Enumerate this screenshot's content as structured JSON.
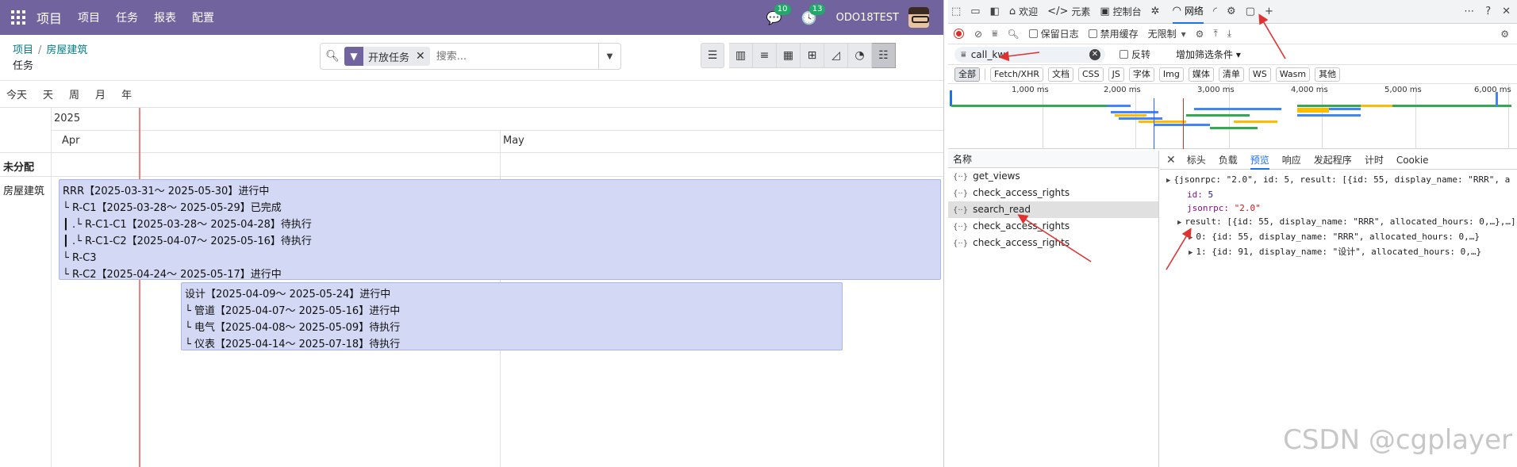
{
  "odoo": {
    "nav": {
      "brand": "项目",
      "links": [
        "项目",
        "任务",
        "报表",
        "配置"
      ],
      "chat_badge": "10",
      "activity_badge": "13",
      "user": "ODO18TEST"
    },
    "breadcrumb": {
      "parent": "项目",
      "current": "房屋建筑"
    },
    "page_title": "任务",
    "search": {
      "facet": "开放任务",
      "placeholder": "搜索..."
    },
    "scales": [
      "今天",
      "天",
      "周",
      "月",
      "年"
    ],
    "gantt": {
      "year": "2025",
      "months": [
        "Apr",
        "May"
      ],
      "rows": [
        "未分配",
        "房屋建筑"
      ],
      "group1": [
        "RRR【2025-03-31～ 2025-05-30】进行中",
        "└ R-C1【2025-03-28～ 2025-05-29】已完成",
        "┃ .└ R-C1-C1【2025-03-28～ 2025-04-28】待执行",
        "┃ .└ R-C1-C2【2025-04-07～ 2025-05-16】待执行",
        "└ R-C3",
        "└ R-C2【2025-04-24～ 2025-05-17】进行中"
      ],
      "group2": [
        "设计【2025-04-09～ 2025-05-24】进行中",
        "└ 管道【2025-04-07～ 2025-05-16】进行中",
        "└ 电气【2025-04-08～ 2025-05-09】待执行",
        "└ 仪表【2025-04-14～ 2025-07-18】待执行"
      ]
    }
  },
  "devtools": {
    "tabs": {
      "welcome": "欢迎",
      "elements": "元素",
      "console": "控制台",
      "network": "网络"
    },
    "toolbar": {
      "preserve_log": "保留日志",
      "disable_cache": "禁用缓存",
      "throttle": "无限制"
    },
    "filter": {
      "value": "call_kw",
      "invert": "反转",
      "more": "增加筛选条件"
    },
    "types": [
      "全部",
      "Fetch/XHR",
      "文档",
      "CSS",
      "JS",
      "字体",
      "Img",
      "媒体",
      "清单",
      "WS",
      "Wasm",
      "其他"
    ],
    "overview_ticks": [
      "1,000 ms",
      "2,000 ms",
      "3,000 ms",
      "4,000 ms",
      "5,000 ms",
      "6,000 ms"
    ],
    "names_header": "名称",
    "requests": [
      "get_views",
      "check_access_rights",
      "search_read",
      "check_access_rights",
      "check_access_rights"
    ],
    "preview_tabs": [
      "标头",
      "负载",
      "预览",
      "响应",
      "发起程序",
      "计时",
      "Cookie"
    ],
    "preview": {
      "line1": "{jsonrpc: \"2.0\", id: 5, result: [{id: 55, display_name: \"RRR\", a",
      "id_key": "id: ",
      "id_val": "5",
      "jsonrpc_key": "jsonrpc: ",
      "jsonrpc_val": "\"2.0\"",
      "result_line": "result: [{id: 55, display_name: \"RRR\", allocated_hours: 0,…},…]",
      "item0": "0: {id: 55, display_name: \"RRR\", allocated_hours: 0,…}",
      "item1": "1: {id: 91, display_name: \"设计\", allocated_hours: 0,…}"
    },
    "watermark": "CSDN @cgplayer"
  }
}
